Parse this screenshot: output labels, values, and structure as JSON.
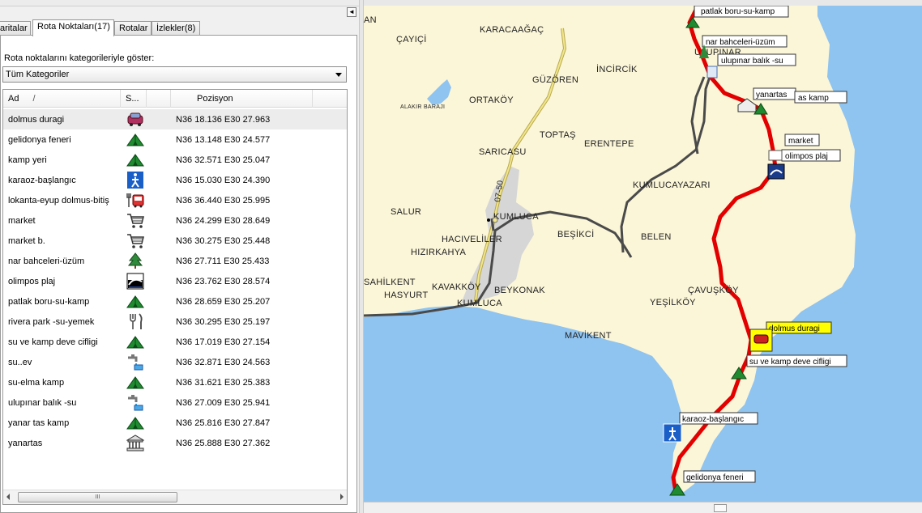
{
  "tabs": [
    {
      "label": "aritalar"
    },
    {
      "label": "Rota Noktaları(17)"
    },
    {
      "label": "Rotalar"
    },
    {
      "label": "İzlekler(8)"
    }
  ],
  "collapse_glyph": "◄",
  "category_label": "Rota noktalarını kategorileriyle göster:",
  "category_select": "Tüm Kategoriler",
  "columns": {
    "name": "Ad",
    "sort": "/",
    "symbol": "S...",
    "position": "Pozisyon"
  },
  "waypoints": [
    {
      "name": "dolmus duragi",
      "icon": "car-icon",
      "position": "N36 18.136 E30 27.963"
    },
    {
      "name": "gelidonya feneri",
      "icon": "tent-icon",
      "position": "N36 13.148 E30 24.577"
    },
    {
      "name": "kamp yeri",
      "icon": "tent-icon",
      "position": "N36 32.571 E30 25.047"
    },
    {
      "name": "karaoz-başlangıc",
      "icon": "hiker-icon",
      "position": "N36 15.030 E30 24.390"
    },
    {
      "name": "lokanta-eyup dolmus-bitiş",
      "icon": "bus-restaurant-icon",
      "position": "N36 36.440 E30 25.995"
    },
    {
      "name": "market",
      "icon": "shopping-cart-icon",
      "position": "N36 24.299 E30 28.649"
    },
    {
      "name": "market b.",
      "icon": "shopping-cart-icon",
      "position": "N36 30.275 E30 25.448"
    },
    {
      "name": "nar bahceleri-üzüm",
      "icon": "tree-icon",
      "position": "N36 27.711 E30 25.433"
    },
    {
      "name": "olimpos plaj",
      "icon": "beach-icon",
      "position": "N36 23.762 E30 28.574"
    },
    {
      "name": "patlak boru-su-kamp",
      "icon": "tent-icon",
      "position": "N36 28.659 E30 25.207"
    },
    {
      "name": "rivera park -su-yemek",
      "icon": "fork-knife-icon",
      "position": "N36 30.295 E30 25.197"
    },
    {
      "name": "su ve kamp deve cifligi",
      "icon": "tent-icon",
      "position": "N36 17.019 E30 27.154"
    },
    {
      "name": "su..ev",
      "icon": "water-tap-icon",
      "position": "N36 32.871 E30 24.563"
    },
    {
      "name": "su-elma kamp",
      "icon": "tent-icon",
      "position": "N36 31.621 E30 25.383"
    },
    {
      "name": "ulupınar balık -su",
      "icon": "water-tap-icon",
      "position": "N36 27.009 E30 25.941"
    },
    {
      "name": "yanar tas kamp",
      "icon": "tent-icon",
      "position": "N36 25.816 E30 27.847"
    },
    {
      "name": "yanartas",
      "icon": "monument-icon",
      "position": "N36 25.888 E30 27.362"
    }
  ],
  "scroll_grip": "III",
  "map": {
    "places": [
      "AN",
      "ÇAYIÇİ",
      "KARACAAĞAÇ",
      "GÜZÖREN",
      "İNCİRCİK",
      "ULUPINAR",
      "ALAKIR BARAJI",
      "ORTAKÖY",
      "TOPTAŞ",
      "ERENTEPE",
      "SARICASU",
      "KUMLUCAYAZARI",
      "SALUR",
      "KUMLUCA",
      "BEŞİKCİ",
      "BELEN",
      "HACIVELİLER",
      "HIZIRKAHYA",
      "SAHİLKENT",
      "HASYURT",
      "KAVAKKÖY",
      "BEYKONAK",
      "KUMLUCA",
      "ÇAVUŞKÖY",
      "YEŞİLKÖY",
      "MAVİKENT"
    ],
    "road_label": "07-50",
    "waypoint_labels": [
      "patlak boru-su-kamp",
      "nar bahceleri-üzüm",
      "ulupınar balık -su",
      "yanartas",
      "as kamp",
      "market",
      "olimpos plaj",
      "dolmus duragi",
      "su ve kamp deve cifligi",
      "karaoz-başlangıc",
      "gelidonya feneri"
    ],
    "colors": {
      "sea": "#8fc3f0",
      "land": "#fbf6d8",
      "urban": "#d6d6d6",
      "route": "#e30000",
      "road": "#4a4a4a",
      "highway": "#e8d870",
      "highlight": "#ffff00"
    }
  }
}
